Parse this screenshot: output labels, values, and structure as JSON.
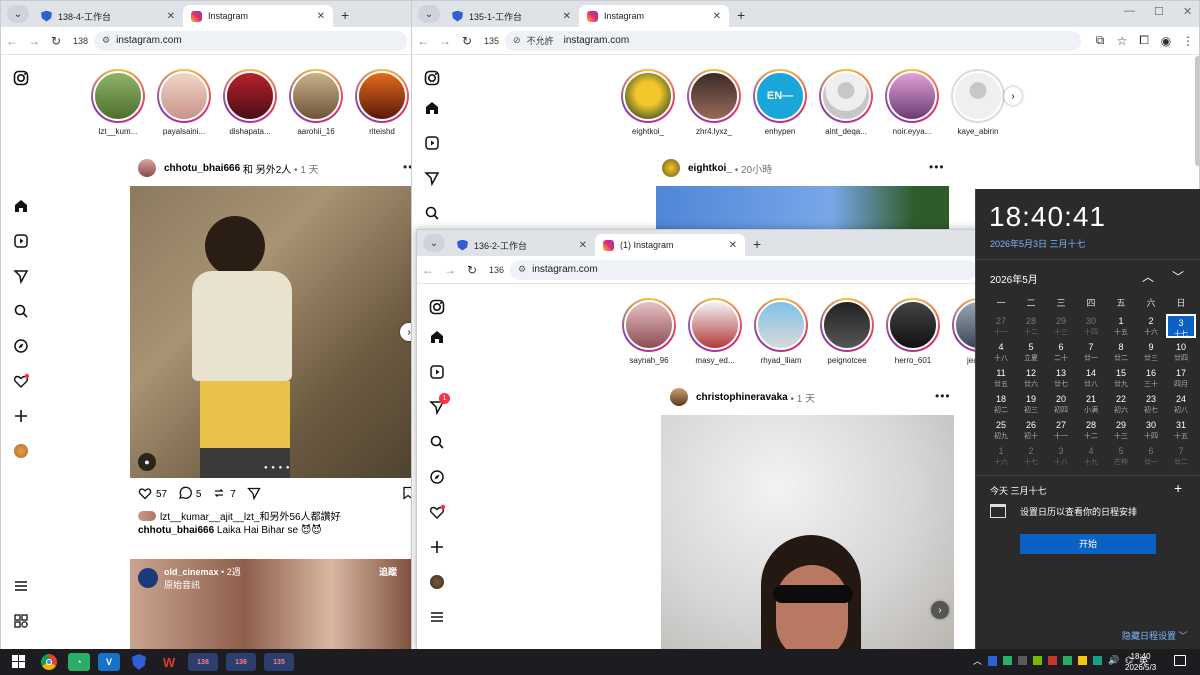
{
  "win138": {
    "tabs": [
      {
        "label": "138-4-工作台"
      },
      {
        "label": "Instagram"
      }
    ],
    "page_num": "138",
    "url": "instagram.com",
    "stories": [
      {
        "name": "lzt__kum..."
      },
      {
        "name": "payalsaini..."
      },
      {
        "name": "dishapata..."
      },
      {
        "name": "aarohii_16"
      },
      {
        "name": "riteishd"
      }
    ],
    "post1": {
      "user": "chhotu_bhai666",
      "with": "和 另外2人",
      "time": "• 1 天",
      "likes": "57",
      "comments": "5",
      "reposts": "7",
      "liked_by": "lzt__kumar__ajit__lzt_和另外56人都讚好",
      "caption_user": "chhotu_bhai666",
      "caption": "Laika Hai Bihar se 😈😈"
    },
    "post2": {
      "user": "old_cinemax",
      "time": "• 2週",
      "subtitle": "原始音訊",
      "follow": "追蹤"
    }
  },
  "win135": {
    "tabs": [
      {
        "label": "135-1-工作台"
      },
      {
        "label": "Instagram"
      }
    ],
    "page_num": "135",
    "not_secure": "不允許",
    "url": "instagram.com",
    "stories": [
      {
        "name": "eightkoi_"
      },
      {
        "name": "zhr4.lyxz_"
      },
      {
        "name": "enhypen"
      },
      {
        "name": "aint_deqa..."
      },
      {
        "name": "noir.eyya..."
      },
      {
        "name": "kaye_abirin"
      }
    ],
    "enhypen_logo": "EN—",
    "post": {
      "user": "eightkoi_",
      "time": "• 20小時"
    }
  },
  "win136": {
    "tabs": [
      {
        "label": "136-2-工作台"
      },
      {
        "label": "(1) Instagram"
      }
    ],
    "page_num": "136",
    "url": "instagram.com",
    "stories": [
      {
        "name": "saynah_96"
      },
      {
        "name": "masy_ed..."
      },
      {
        "name": "rhyad_lliam"
      },
      {
        "name": "peignotcee"
      },
      {
        "name": "herro_601"
      },
      {
        "name": "jeanne"
      }
    ],
    "notif_badge": "1",
    "post": {
      "user": "christophineravaka",
      "time": "• 1 天"
    }
  },
  "calendar": {
    "time": "18:40:41",
    "date_line": "2026年5月3日 三月十七",
    "month": "2026年5月",
    "weekdays": [
      "一",
      "二",
      "三",
      "四",
      "五",
      "六",
      "日"
    ],
    "days": [
      {
        "d": "27",
        "l": "十一",
        "dim": true
      },
      {
        "d": "28",
        "l": "十二",
        "dim": true
      },
      {
        "d": "29",
        "l": "十三",
        "dim": true
      },
      {
        "d": "30",
        "l": "十四",
        "dim": true
      },
      {
        "d": "1",
        "l": "十五"
      },
      {
        "d": "2",
        "l": "十六"
      },
      {
        "d": "3",
        "l": "十七",
        "today": true
      },
      {
        "d": "4",
        "l": "十八"
      },
      {
        "d": "5",
        "l": "立夏"
      },
      {
        "d": "6",
        "l": "二十"
      },
      {
        "d": "7",
        "l": "廿一"
      },
      {
        "d": "8",
        "l": "廿二"
      },
      {
        "d": "9",
        "l": "廿三"
      },
      {
        "d": "10",
        "l": "廿四"
      },
      {
        "d": "11",
        "l": "廿五"
      },
      {
        "d": "12",
        "l": "廿六"
      },
      {
        "d": "13",
        "l": "廿七"
      },
      {
        "d": "14",
        "l": "廿八"
      },
      {
        "d": "15",
        "l": "廿九"
      },
      {
        "d": "16",
        "l": "三十"
      },
      {
        "d": "17",
        "l": "四月"
      },
      {
        "d": "18",
        "l": "初二"
      },
      {
        "d": "19",
        "l": "初三"
      },
      {
        "d": "20",
        "l": "初四"
      },
      {
        "d": "21",
        "l": "小满"
      },
      {
        "d": "22",
        "l": "初六"
      },
      {
        "d": "23",
        "l": "初七"
      },
      {
        "d": "24",
        "l": "初八"
      },
      {
        "d": "25",
        "l": "初九"
      },
      {
        "d": "26",
        "l": "初十"
      },
      {
        "d": "27",
        "l": "十一"
      },
      {
        "d": "28",
        "l": "十二"
      },
      {
        "d": "29",
        "l": "十三"
      },
      {
        "d": "30",
        "l": "十四"
      },
      {
        "d": "31",
        "l": "十五"
      },
      {
        "d": "1",
        "l": "十六",
        "dim": true
      },
      {
        "d": "2",
        "l": "十七",
        "dim": true
      },
      {
        "d": "3",
        "l": "十八",
        "dim": true
      },
      {
        "d": "4",
        "l": "十九",
        "dim": true
      },
      {
        "d": "5",
        "l": "芒种",
        "dim": true
      },
      {
        "d": "6",
        "l": "廿一",
        "dim": true
      },
      {
        "d": "7",
        "l": "廿二",
        "dim": true
      }
    ],
    "today_label": "今天 三月十七",
    "agenda_text": "设置日历以查看你的日程安排",
    "start_button": "开始",
    "hide_schedule": "隐藏日程设置 ﹀"
  },
  "taskbar": {
    "items": [
      {
        "label": "138"
      },
      {
        "label": "136"
      },
      {
        "label": "135"
      }
    ],
    "ime": "英",
    "clock_time": "18:40",
    "clock_date": "2026/5/3"
  }
}
